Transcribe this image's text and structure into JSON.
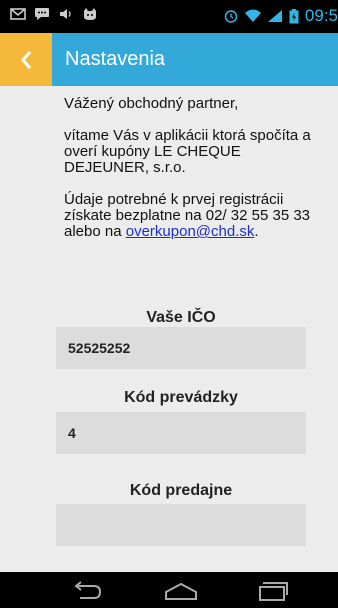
{
  "status_bar": {
    "icons_left": [
      "mail-icon",
      "chat-icon",
      "volume-icon",
      "cat-icon"
    ],
    "icons_right": [
      "alarm-icon",
      "wifi-icon",
      "signal-icon",
      "battery-icon"
    ],
    "time": "09:5"
  },
  "action_bar": {
    "title": "Nastavenia",
    "back_icon": "chevron-left-icon",
    "colors": {
      "bar": "#32a9d8",
      "back": "#f4b93a"
    }
  },
  "intro": {
    "greeting": "Vážený obchodný partner,",
    "welcome": "vítame Vás v aplikácii ktorá spočíta a overí kupóny LE CHEQUE DEJEUNER, s.r.o.",
    "registration_text": "Údaje potrebné k prvej registrácii získate bezplatne na 02/ 32 55 35 33 alebo na",
    "email": "overkupon@chd.sk",
    "period": "."
  },
  "form": {
    "ico_label": "Vaše IČO",
    "ico_value": "52525252",
    "prevadzka_label": "Kód prevádzky",
    "prevadzka_value": "4",
    "predajna_label": "Kód predajne",
    "predajna_value": ""
  },
  "nav_bar": {
    "icons": [
      "back-nav-icon",
      "home-nav-icon",
      "recents-nav-icon"
    ]
  }
}
